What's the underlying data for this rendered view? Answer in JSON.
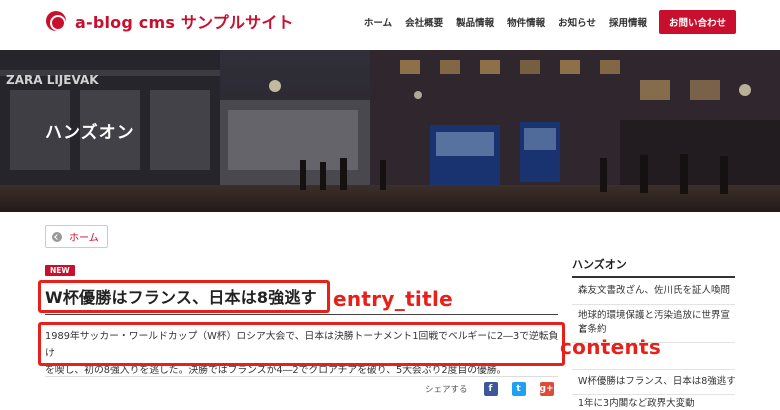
{
  "site": {
    "logo_text": "a-blog cms サンプルサイト"
  },
  "nav": {
    "items": [
      "ホーム",
      "会社概要",
      "製品情報",
      "物件情報",
      "お知らせ",
      "採用情報"
    ],
    "contact_label": "お問い合わせ"
  },
  "hero": {
    "title": "ハンズオン",
    "sign_text": "ZARA LIJEVAK"
  },
  "breadcrumb": {
    "home_label": "ホーム"
  },
  "entry": {
    "badge": "NEW",
    "title": "W杯優勝はフランス、日本は8強逃す",
    "body_line1": "1989年サッカー・ワールドカップ（W杯）ロシア大会で、日本は決勝トーナメント1回戦でベルギーに2―3で逆転負け",
    "body_line2": "を喫し、初の8強入りを逃した。決勝ではフランスが4―2でクロアチアを破り、5大会ぶり2度目の優勝。",
    "share_label": "シェアする"
  },
  "annotations": {
    "title_label": "entry_title",
    "contents_label": "contents",
    "color": "#e8201a"
  },
  "sidebar": {
    "title": "ハンズオン",
    "items": [
      "森友文書改ざん、佐川氏を証人喚問",
      "地球的環境保護と汚染追放に世界宣言",
      "と条約",
      "W杯優勝はフランス、日本は8強逃す",
      "1年に3内閣など政界大変動"
    ]
  },
  "share": {
    "facebook_icon": "f",
    "twitter_icon": "t",
    "googleplus_icon": "g+"
  },
  "colors": {
    "brand": "#c8102e",
    "facebook": "#3b5998",
    "twitter": "#1da1f2",
    "googleplus": "#dd4b39"
  }
}
